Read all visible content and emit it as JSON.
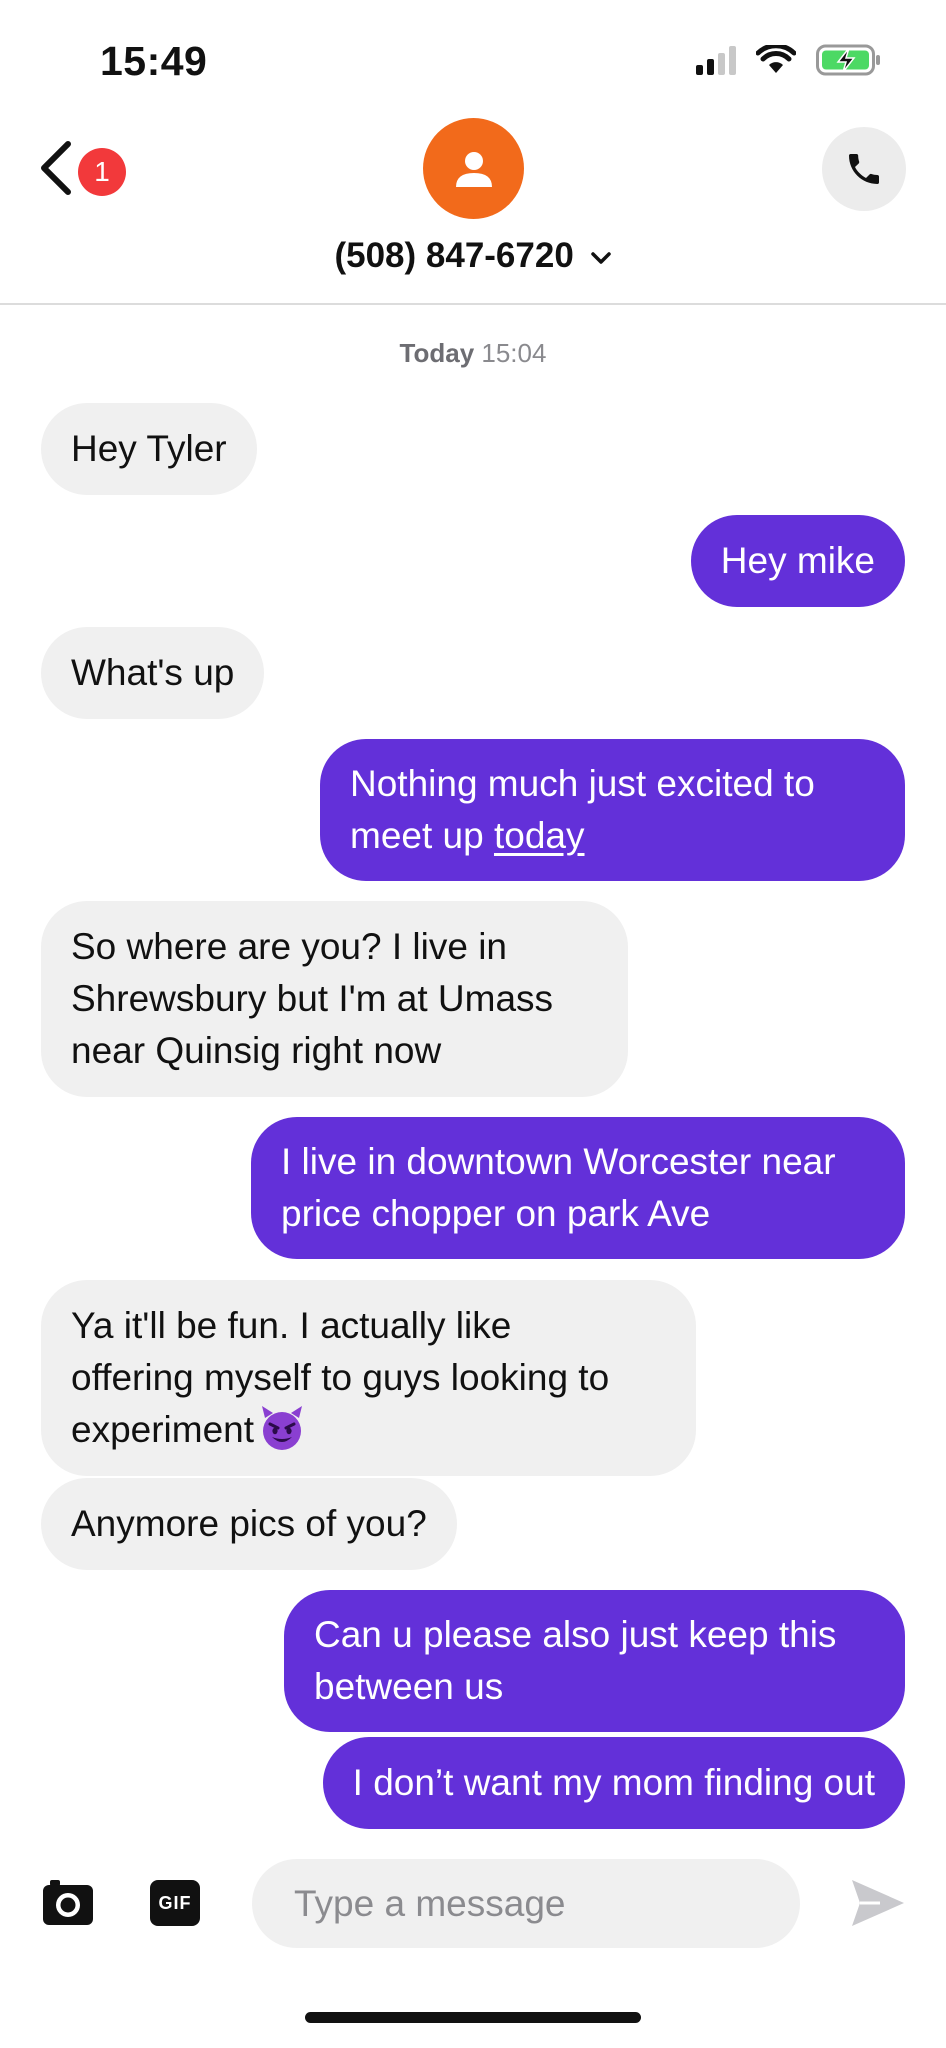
{
  "status_bar": {
    "time": "15:49"
  },
  "header": {
    "unread_count": "1",
    "contact_number": "(508) 847-6720"
  },
  "conversation": {
    "date_label": "Today",
    "time_label": "15:04",
    "messages": [
      {
        "dir": "in",
        "text": "Hey Tyler"
      },
      {
        "dir": "out",
        "text": "Hey mike"
      },
      {
        "dir": "in",
        "text": "What's up"
      },
      {
        "dir": "out",
        "line1": "Nothing much just excited  to",
        "line2_prefix": "meet up ",
        "link": "today"
      },
      {
        "dir": "in",
        "line1": "So where are you?   I live in",
        "line2": "Shrewsbury but I'm at Umass",
        "line3": "near Quinsig right now"
      },
      {
        "dir": "out",
        "line1": "I live in downtown Worcester near",
        "line2": "price chopper on park Ave"
      },
      {
        "dir": "in",
        "line1": "Ya it'll be fun. I actually like",
        "line2": "offering myself to guys looking to",
        "line3": "experiment",
        "emoji": "smiling-devil-emoji"
      },
      {
        "dir": "in",
        "text": "Anymore pics of you?"
      },
      {
        "dir": "out",
        "line1": "Can u please also just keep this",
        "line2": "between us"
      },
      {
        "dir": "out",
        "text": "I don’t want my mom finding out"
      }
    ]
  },
  "composer": {
    "placeholder": "Type a message",
    "gif_label": "GIF"
  },
  "colors": {
    "outgoing_bubble": "#6330d9",
    "incoming_bubble": "#f0f0f0",
    "avatar": "#f26a1b",
    "badge": "#f2393b",
    "battery_charging": "#4cd964"
  },
  "icons": [
    "back-chevron-icon",
    "person-icon",
    "phone-icon",
    "chevron-down-icon",
    "camera-icon",
    "gif-icon",
    "send-icon",
    "signal-icon",
    "wifi-icon",
    "battery-charging-icon"
  ]
}
